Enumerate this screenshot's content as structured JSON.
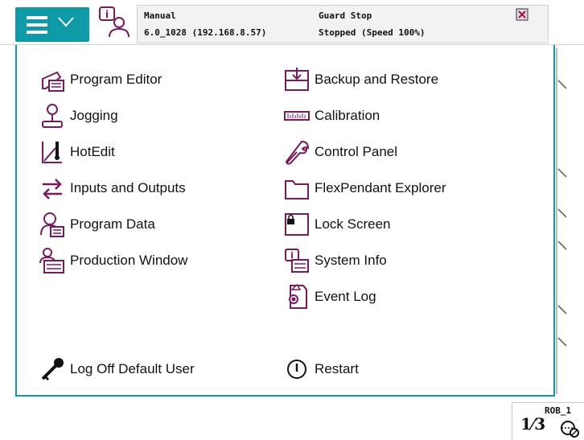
{
  "status": {
    "mode": "Manual",
    "controller": "6.0_1028 (192.168.8.57)",
    "guard": "Guard Stop",
    "state": "Stopped (Speed 100%)"
  },
  "menu": {
    "left": [
      {
        "label": "Program Editor",
        "icon": "program-editor-icon"
      },
      {
        "label": "Jogging",
        "icon": "joystick-icon"
      },
      {
        "label": "HotEdit",
        "icon": "hotedit-icon"
      },
      {
        "label": "Inputs and Outputs",
        "icon": "arrows-io-icon"
      },
      {
        "label": "Program Data",
        "icon": "program-data-icon"
      },
      {
        "label": "Production Window",
        "icon": "production-window-icon"
      }
    ],
    "right": [
      {
        "label": "Backup and Restore",
        "icon": "backup-icon"
      },
      {
        "label": "Calibration",
        "icon": "ruler-icon"
      },
      {
        "label": "Control Panel",
        "icon": "wrench-icon"
      },
      {
        "label": "FlexPendant Explorer",
        "icon": "folder-icon"
      },
      {
        "label": "Lock Screen",
        "icon": "lock-screen-icon"
      },
      {
        "label": "System Info",
        "icon": "system-info-icon"
      },
      {
        "label": "Event Log",
        "icon": "event-log-icon"
      }
    ],
    "logoff": {
      "label": "Log Off Default User",
      "icon": "key-icon"
    },
    "restart": {
      "label": "Restart",
      "icon": "power-icon"
    }
  },
  "quickset": {
    "robot": "ROB_1",
    "fraction": "1⁄3"
  },
  "colors": {
    "accent": "#0e9aa7",
    "icon_purple": "#7a1a5c"
  }
}
